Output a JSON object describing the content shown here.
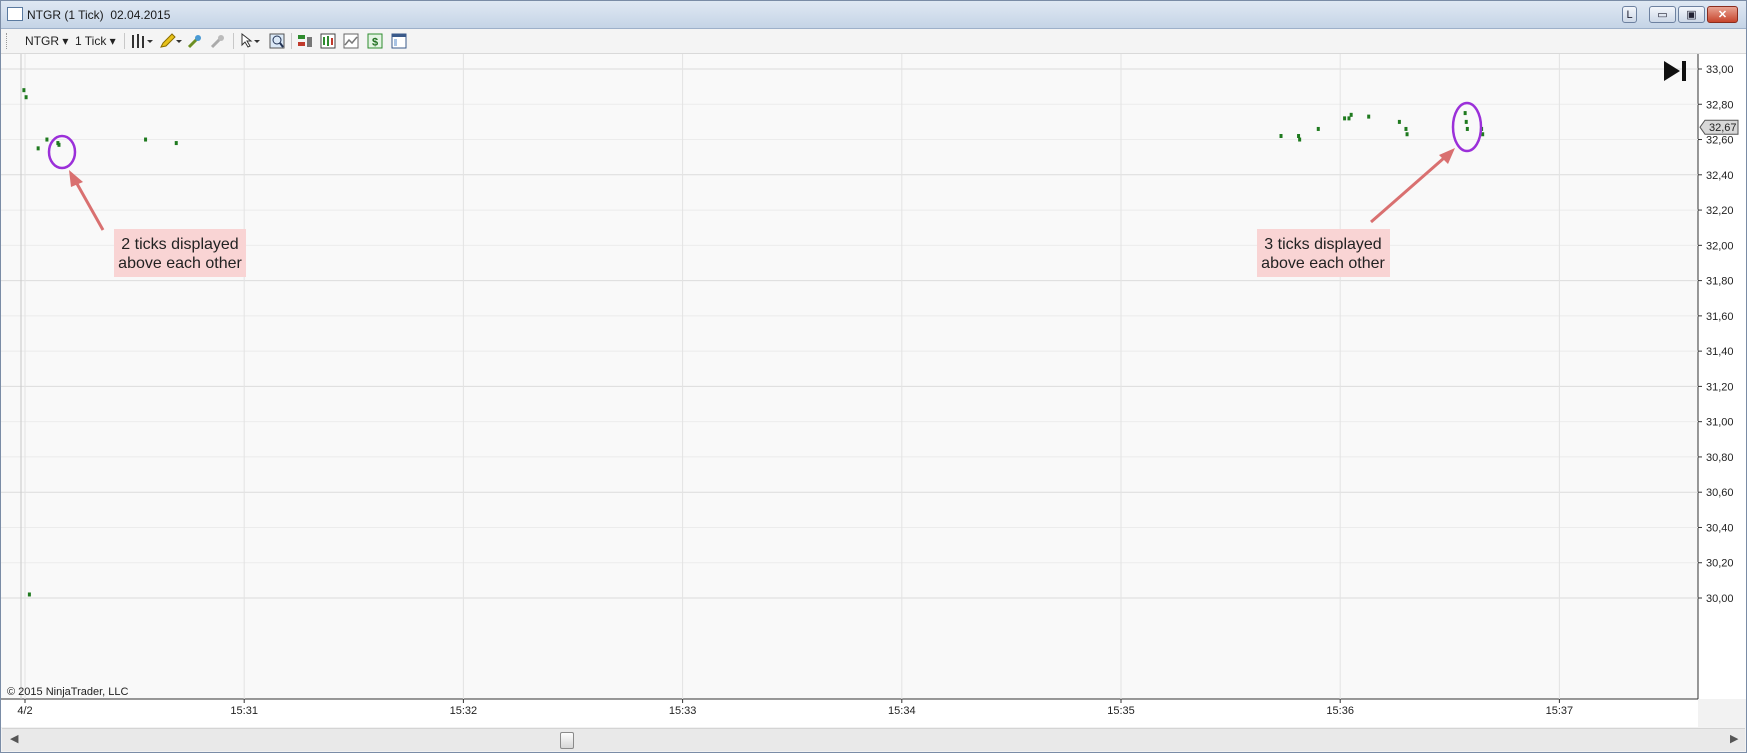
{
  "window": {
    "title": "NTGR (1 Tick)  02.04.2015",
    "buttons": {
      "layout": "L",
      "minimize": "▭",
      "restore": "▣",
      "close": "✕"
    }
  },
  "toolbar": {
    "instrument": "NTGR",
    "interval": "1 Tick",
    "icons": [
      "bar-type-icon",
      "drawing-pencil-icon",
      "indicator-add-icon",
      "strategy-icon",
      "cursor-icon",
      "zoom-icon",
      "chart-trader-icon",
      "data-box-icon",
      "chart-style-icon",
      "dollar-icon",
      "properties-icon"
    ]
  },
  "chart": {
    "copyright": "© 2015 NinjaTrader, LLC",
    "last_price_label": "32,67",
    "skip_to_end_icon": "skip-to-end-icon",
    "annotation_left": {
      "line1": "2 ticks displayed",
      "line2": "above each other"
    },
    "annotation_right": {
      "line1": "3 ticks displayed",
      "line2": "above each other"
    },
    "colors": {
      "tick": "#1f7a1f",
      "grid": "#e3e3e3",
      "background": "#f9f9f9",
      "highlight": "#9b30d9",
      "arrow": "#d97070",
      "callout_bg": "#f9d4d4"
    }
  },
  "chart_data": {
    "type": "scatter",
    "title": "",
    "xlabel": "",
    "ylabel": "",
    "x_ticks": [
      "4/2",
      "15:31",
      "15:32",
      "15:33",
      "15:34",
      "15:35",
      "15:36",
      "15:37"
    ],
    "y_ticks": [
      "33,00",
      "32,80",
      "32,60",
      "32,40",
      "32,20",
      "32,00",
      "31,80",
      "31,60",
      "31,40",
      "31,20",
      "31,00",
      "30,80",
      "30,60",
      "30,40",
      "30,20",
      "30,00"
    ],
    "ylim": [
      29.85,
      33.05
    ],
    "xlim_minutes": [
      -0.02,
      7.7
    ],
    "grid": true,
    "series": [
      {
        "x": [
          -0.005,
          0.005,
          0.02,
          0.06,
          0.1,
          0.15,
          0.155,
          0.55,
          0.69,
          5.73,
          5.81,
          5.815,
          5.9,
          6.02,
          6.05,
          6.04,
          6.13,
          6.27,
          6.3,
          6.305,
          6.57,
          6.575,
          6.58,
          6.645,
          6.65
        ],
        "y": [
          32.88,
          32.84,
          30.02,
          32.55,
          32.6,
          32.58,
          32.57,
          32.6,
          32.58,
          32.62,
          32.62,
          32.6,
          32.66,
          32.72,
          32.74,
          32.72,
          32.73,
          32.7,
          32.66,
          32.63,
          32.75,
          32.7,
          32.66,
          32.66,
          32.63
        ]
      }
    ]
  }
}
